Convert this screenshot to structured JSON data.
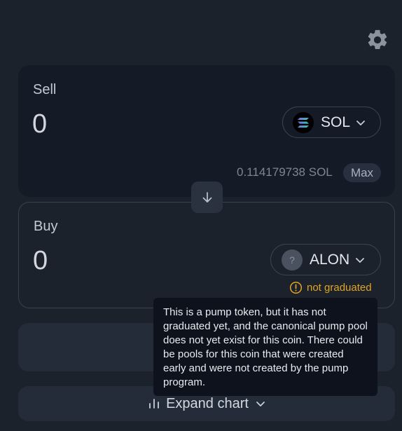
{
  "settings": {
    "icon": "gear-icon"
  },
  "sell": {
    "label": "Sell",
    "amount": "0",
    "token": "SOL",
    "balance": "0.114179738 SOL",
    "max_label": "Max"
  },
  "swap": {
    "icon": "arrow-down-icon"
  },
  "buy": {
    "label": "Buy",
    "amount": "0",
    "token": "ALON",
    "token_icon_glyph": "?",
    "status": "not graduated"
  },
  "tooltip": {
    "text": "This is a pump token, but it has not graduated yet, and the canonical pump pool does not yet exist for this coin. There could be pools for this coin that were created early and were not created by the pump program."
  },
  "expand_chart": {
    "label": "Expand chart"
  },
  "colors": {
    "background": "#1c222c",
    "card": "#141a26",
    "warning": "#e0a422"
  }
}
